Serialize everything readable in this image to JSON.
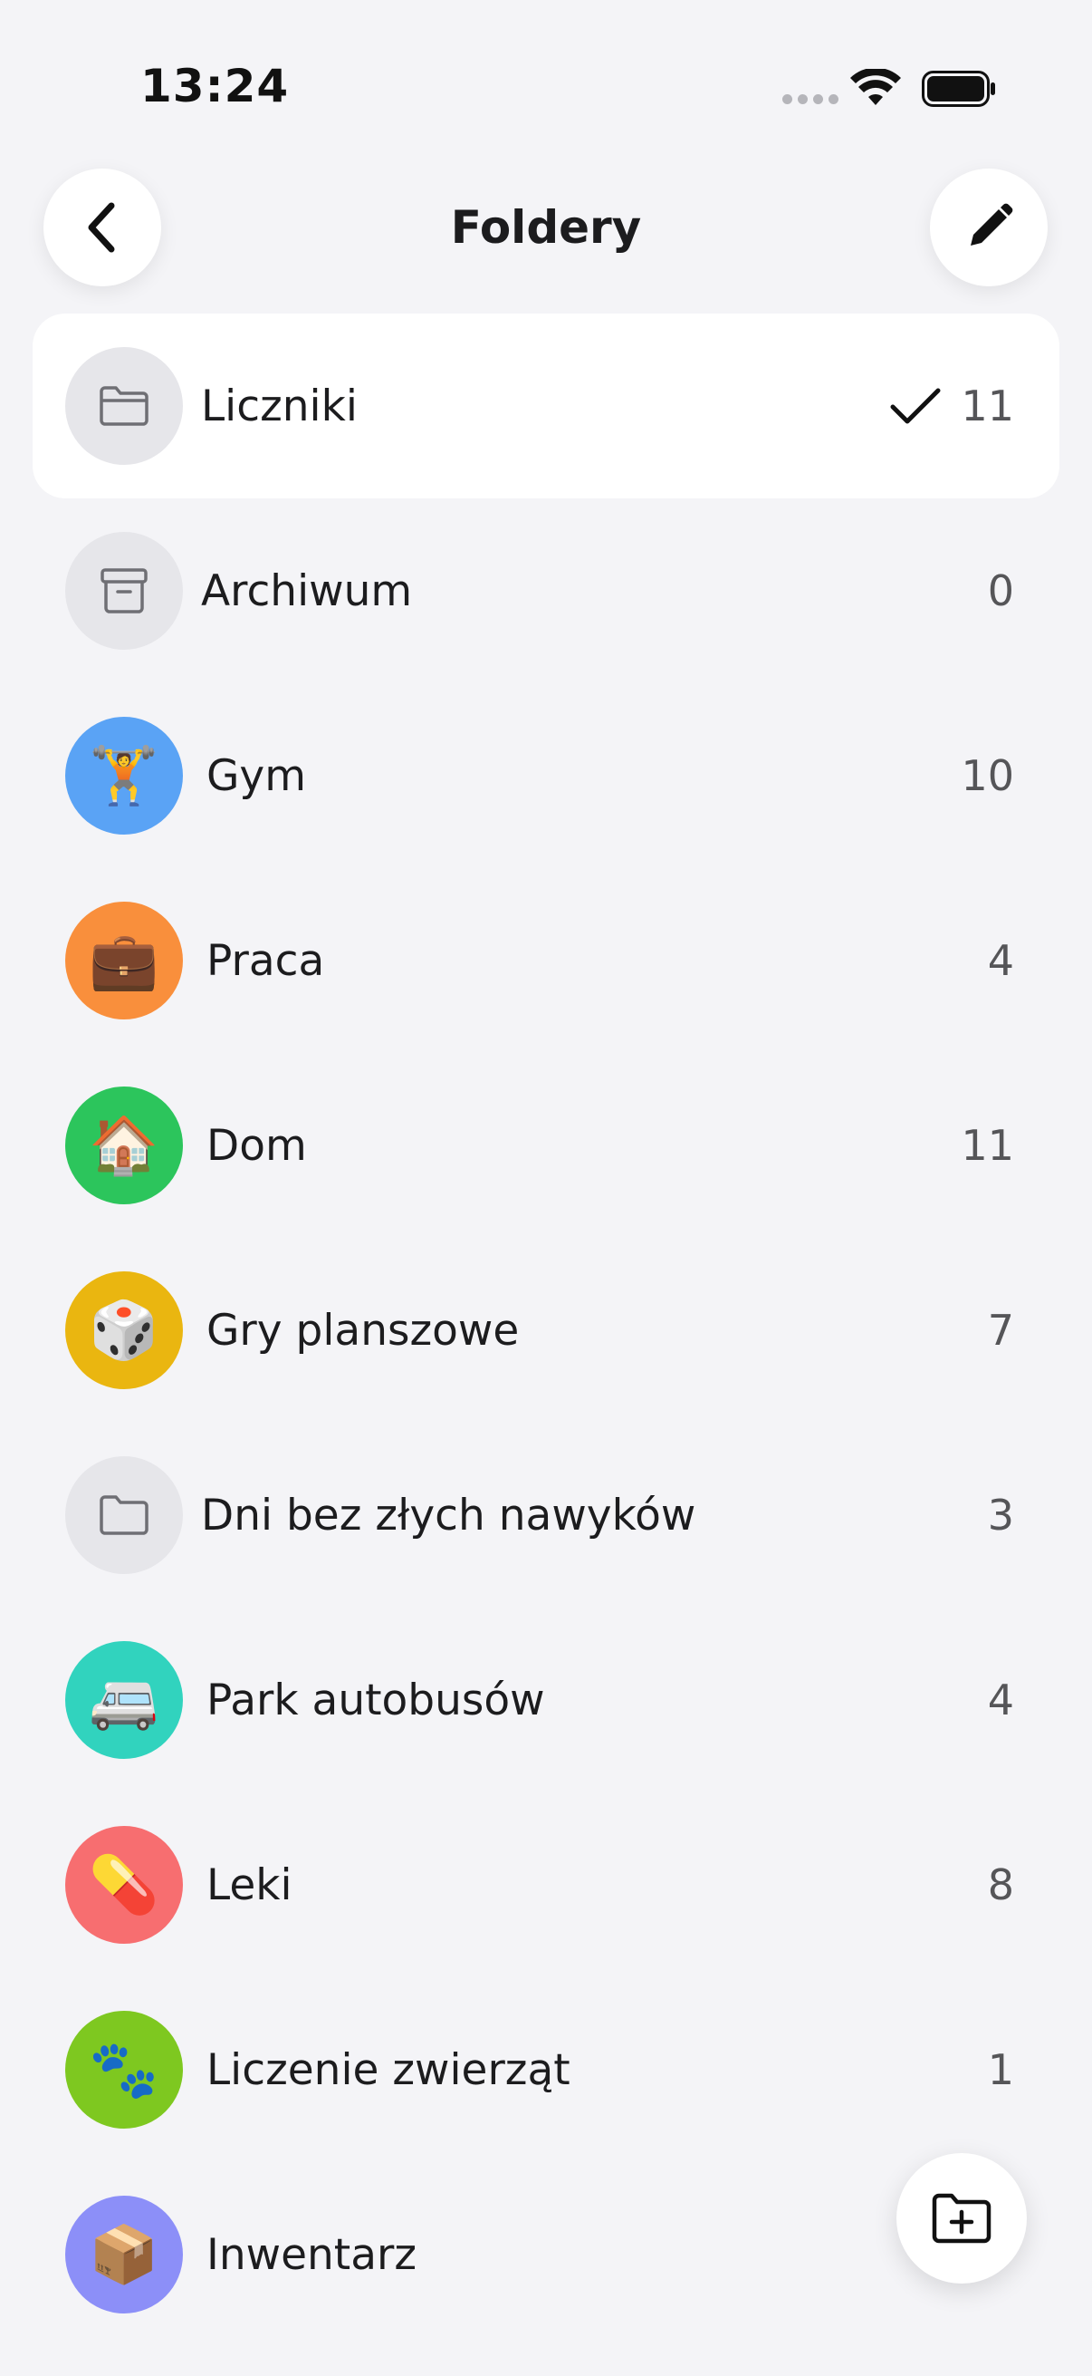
{
  "status_bar": {
    "time": "13:24"
  },
  "header": {
    "title": "Foldery",
    "back_icon": "chevron-left-icon",
    "edit_icon": "pencil-icon"
  },
  "folders": [
    {
      "label": "Liczniki",
      "count": "11",
      "icon": "folder-outline-icon",
      "color": "#e6e6ea",
      "selected": true
    },
    {
      "label": "Archiwum",
      "count": "0",
      "icon": "archive-box-icon",
      "color": "#e6e6ea"
    },
    {
      "label": "Gym",
      "count": "10",
      "icon": "🏋️",
      "color": "#5aa3f5"
    },
    {
      "label": "Praca",
      "count": "4",
      "icon": "💼",
      "color": "#f98f3c"
    },
    {
      "label": "Dom",
      "count": "11",
      "icon": "🏠",
      "color": "#2cc55c"
    },
    {
      "label": "Gry planszowe",
      "count": "7",
      "icon": "🎲",
      "color": "#eab610"
    },
    {
      "label": "Dni bez złych nawyków",
      "count": "3",
      "icon": "folder-outline-icon",
      "color": "#e6e6ea"
    },
    {
      "label": "Park autobusów",
      "count": "4",
      "icon": "🚐",
      "color": "#31d3be"
    },
    {
      "label": "Leki",
      "count": "8",
      "icon": "💊",
      "color": "#f76e70"
    },
    {
      "label": "Liczenie zwierząt",
      "count": "1",
      "icon": "🐾",
      "color": "#7ec820"
    },
    {
      "label": "Inwentarz",
      "count": "",
      "icon": "📦",
      "color": "#8c8ff8"
    }
  ],
  "fab": {
    "icon": "folder-plus-icon"
  }
}
